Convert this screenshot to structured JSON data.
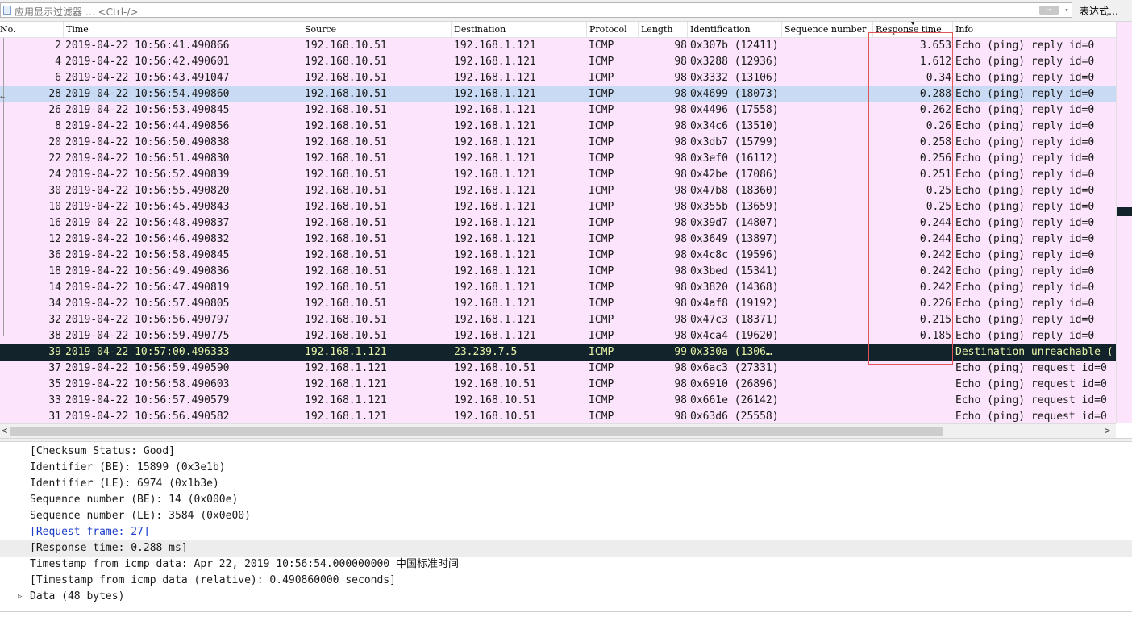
{
  "filter": {
    "placeholder": "应用显示过滤器 … <Ctrl-/>",
    "apply_label": "⇨",
    "dropdown_label": "▾",
    "expression_label": "表达式…"
  },
  "columns": [
    {
      "key": "no",
      "label": "No."
    },
    {
      "key": "time",
      "label": "Time"
    },
    {
      "key": "source",
      "label": "Source"
    },
    {
      "key": "destination",
      "label": "Destination"
    },
    {
      "key": "protocol",
      "label": "Protocol"
    },
    {
      "key": "length",
      "label": "Length"
    },
    {
      "key": "identification",
      "label": "Identification"
    },
    {
      "key": "sequence_number",
      "label": "Sequence number"
    },
    {
      "key": "response_time",
      "label": "Response time"
    },
    {
      "key": "info",
      "label": "Info"
    }
  ],
  "sort_indicator": "▼",
  "packets": [
    {
      "no": "2",
      "time": "2019-04-22 10:56:41.490866",
      "src": "192.168.10.51",
      "dst": "192.168.1.121",
      "proto": "ICMP",
      "len": "98",
      "id": "0x307b (12411)",
      "seq": "",
      "resp": "3.653",
      "info": "Echo (ping) reply    id=0",
      "style": "normal"
    },
    {
      "no": "4",
      "time": "2019-04-22 10:56:42.490601",
      "src": "192.168.10.51",
      "dst": "192.168.1.121",
      "proto": "ICMP",
      "len": "98",
      "id": "0x3288 (12936)",
      "seq": "",
      "resp": "1.612",
      "info": "Echo (ping) reply    id=0",
      "style": "normal"
    },
    {
      "no": "6",
      "time": "2019-04-22 10:56:43.491047",
      "src": "192.168.10.51",
      "dst": "192.168.1.121",
      "proto": "ICMP",
      "len": "98",
      "id": "0x3332 (13106)",
      "seq": "",
      "resp": "0.34",
      "info": "Echo (ping) reply    id=0",
      "style": "normal"
    },
    {
      "no": "28",
      "time": "2019-04-22 10:56:54.490860",
      "src": "192.168.10.51",
      "dst": "192.168.1.121",
      "proto": "ICMP",
      "len": "98",
      "id": "0x4699 (18073)",
      "seq": "",
      "resp": "0.288",
      "info": "Echo (ping) reply    id=0",
      "style": "sel"
    },
    {
      "no": "26",
      "time": "2019-04-22 10:56:53.490845",
      "src": "192.168.10.51",
      "dst": "192.168.1.121",
      "proto": "ICMP",
      "len": "98",
      "id": "0x4496 (17558)",
      "seq": "",
      "resp": "0.262",
      "info": "Echo (ping) reply    id=0",
      "style": "normal"
    },
    {
      "no": "8",
      "time": "2019-04-22 10:56:44.490856",
      "src": "192.168.10.51",
      "dst": "192.168.1.121",
      "proto": "ICMP",
      "len": "98",
      "id": "0x34c6 (13510)",
      "seq": "",
      "resp": "0.26",
      "info": "Echo (ping) reply    id=0",
      "style": "normal"
    },
    {
      "no": "20",
      "time": "2019-04-22 10:56:50.490838",
      "src": "192.168.10.51",
      "dst": "192.168.1.121",
      "proto": "ICMP",
      "len": "98",
      "id": "0x3db7 (15799)",
      "seq": "",
      "resp": "0.258",
      "info": "Echo (ping) reply    id=0",
      "style": "normal"
    },
    {
      "no": "22",
      "time": "2019-04-22 10:56:51.490830",
      "src": "192.168.10.51",
      "dst": "192.168.1.121",
      "proto": "ICMP",
      "len": "98",
      "id": "0x3ef0 (16112)",
      "seq": "",
      "resp": "0.256",
      "info": "Echo (ping) reply    id=0",
      "style": "normal"
    },
    {
      "no": "24",
      "time": "2019-04-22 10:56:52.490839",
      "src": "192.168.10.51",
      "dst": "192.168.1.121",
      "proto": "ICMP",
      "len": "98",
      "id": "0x42be (17086)",
      "seq": "",
      "resp": "0.251",
      "info": "Echo (ping) reply    id=0",
      "style": "normal"
    },
    {
      "no": "30",
      "time": "2019-04-22 10:56:55.490820",
      "src": "192.168.10.51",
      "dst": "192.168.1.121",
      "proto": "ICMP",
      "len": "98",
      "id": "0x47b8 (18360)",
      "seq": "",
      "resp": "0.25",
      "info": "Echo (ping) reply    id=0",
      "style": "normal"
    },
    {
      "no": "10",
      "time": "2019-04-22 10:56:45.490843",
      "src": "192.168.10.51",
      "dst": "192.168.1.121",
      "proto": "ICMP",
      "len": "98",
      "id": "0x355b (13659)",
      "seq": "",
      "resp": "0.25",
      "info": "Echo (ping) reply    id=0",
      "style": "normal"
    },
    {
      "no": "16",
      "time": "2019-04-22 10:56:48.490837",
      "src": "192.168.10.51",
      "dst": "192.168.1.121",
      "proto": "ICMP",
      "len": "98",
      "id": "0x39d7 (14807)",
      "seq": "",
      "resp": "0.244",
      "info": "Echo (ping) reply    id=0",
      "style": "normal"
    },
    {
      "no": "12",
      "time": "2019-04-22 10:56:46.490832",
      "src": "192.168.10.51",
      "dst": "192.168.1.121",
      "proto": "ICMP",
      "len": "98",
      "id": "0x3649 (13897)",
      "seq": "",
      "resp": "0.244",
      "info": "Echo (ping) reply    id=0",
      "style": "normal"
    },
    {
      "no": "36",
      "time": "2019-04-22 10:56:58.490845",
      "src": "192.168.10.51",
      "dst": "192.168.1.121",
      "proto": "ICMP",
      "len": "98",
      "id": "0x4c8c (19596)",
      "seq": "",
      "resp": "0.242",
      "info": "Echo (ping) reply    id=0",
      "style": "normal"
    },
    {
      "no": "18",
      "time": "2019-04-22 10:56:49.490836",
      "src": "192.168.10.51",
      "dst": "192.168.1.121",
      "proto": "ICMP",
      "len": "98",
      "id": "0x3bed (15341)",
      "seq": "",
      "resp": "0.242",
      "info": "Echo (ping) reply    id=0",
      "style": "normal"
    },
    {
      "no": "14",
      "time": "2019-04-22 10:56:47.490819",
      "src": "192.168.10.51",
      "dst": "192.168.1.121",
      "proto": "ICMP",
      "len": "98",
      "id": "0x3820 (14368)",
      "seq": "",
      "resp": "0.242",
      "info": "Echo (ping) reply    id=0",
      "style": "normal"
    },
    {
      "no": "34",
      "time": "2019-04-22 10:56:57.490805",
      "src": "192.168.10.51",
      "dst": "192.168.1.121",
      "proto": "ICMP",
      "len": "98",
      "id": "0x4af8 (19192)",
      "seq": "",
      "resp": "0.226",
      "info": "Echo (ping) reply    id=0",
      "style": "normal"
    },
    {
      "no": "32",
      "time": "2019-04-22 10:56:56.490797",
      "src": "192.168.10.51",
      "dst": "192.168.1.121",
      "proto": "ICMP",
      "len": "98",
      "id": "0x47c3 (18371)",
      "seq": "",
      "resp": "0.215",
      "info": "Echo (ping) reply    id=0",
      "style": "normal"
    },
    {
      "no": "38",
      "time": "2019-04-22 10:56:59.490775",
      "src": "192.168.10.51",
      "dst": "192.168.1.121",
      "proto": "ICMP",
      "len": "98",
      "id": "0x4ca4 (19620)",
      "seq": "",
      "resp": "0.185",
      "info": "Echo (ping) reply    id=0",
      "style": "normal"
    },
    {
      "no": "39",
      "time": "2019-04-22 10:57:00.496333",
      "src": "192.168.1.121",
      "dst": "23.239.7.5",
      "proto": "ICMP",
      "len": "99",
      "id": "0x330a (1306…",
      "seq": "",
      "resp": "",
      "info": "Destination unreachable (",
      "style": "dark"
    },
    {
      "no": "37",
      "time": "2019-04-22 10:56:59.490590",
      "src": "192.168.1.121",
      "dst": "192.168.10.51",
      "proto": "ICMP",
      "len": "98",
      "id": "0x6ac3 (27331)",
      "seq": "",
      "resp": "",
      "info": "Echo (ping) request  id=0",
      "style": "normal"
    },
    {
      "no": "35",
      "time": "2019-04-22 10:56:58.490603",
      "src": "192.168.1.121",
      "dst": "192.168.10.51",
      "proto": "ICMP",
      "len": "98",
      "id": "0x6910 (26896)",
      "seq": "",
      "resp": "",
      "info": "Echo (ping) request  id=0",
      "style": "normal"
    },
    {
      "no": "33",
      "time": "2019-04-22 10:56:57.490579",
      "src": "192.168.1.121",
      "dst": "192.168.10.51",
      "proto": "ICMP",
      "len": "98",
      "id": "0x661e (26142)",
      "seq": "",
      "resp": "",
      "info": "Echo (ping) request  id=0",
      "style": "normal"
    },
    {
      "no": "31",
      "time": "2019-04-22 10:56:56.490582",
      "src": "192.168.1.121",
      "dst": "192.168.10.51",
      "proto": "ICMP",
      "len": "98",
      "id": "0x63d6 (25558)",
      "seq": "",
      "resp": "",
      "info": "Echo (ping) request  id=0",
      "style": "normal"
    }
  ],
  "scroll": {
    "left": "<",
    "right": ">"
  },
  "details": [
    {
      "text": "[Checksum Status: Good]",
      "kind": "plain"
    },
    {
      "text": "Identifier (BE): 15899 (0x3e1b)",
      "kind": "plain"
    },
    {
      "text": "Identifier (LE): 6974 (0x1b3e)",
      "kind": "plain"
    },
    {
      "text": "Sequence number (BE): 14 (0x000e)",
      "kind": "plain"
    },
    {
      "text": "Sequence number (LE): 3584 (0x0e00)",
      "kind": "plain"
    },
    {
      "text": "[Request frame: 27]",
      "kind": "link"
    },
    {
      "text": "[Response time: 0.288 ms]",
      "kind": "hl"
    },
    {
      "text": "Timestamp from icmp data: Apr 22, 2019 10:56:54.000000000 中国标准时间",
      "kind": "plain"
    },
    {
      "text": "[Timestamp from icmp data (relative): 0.490860000 seconds]",
      "kind": "plain"
    },
    {
      "text": "Data (48 bytes)",
      "kind": "expandable"
    }
  ],
  "colors": {
    "row_bg": "#fce4fc",
    "selected_bg": "#c9dbf4",
    "dark_bg": "#13232b",
    "dark_fg": "#e6f3a8",
    "highlight_box": "#e05555"
  }
}
